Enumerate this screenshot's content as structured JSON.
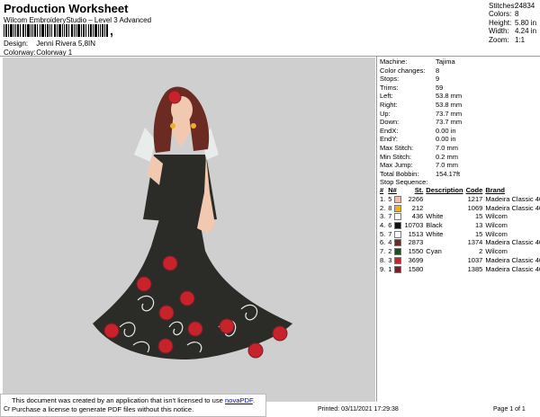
{
  "header": {
    "title": "Production Worksheet",
    "software": "Wilcom EmbroideryStudio – Level 3 Advanced",
    "barcode_suffix": ",",
    "design_label": "Design:",
    "design_value": "Jenni Rivera 5,8IN",
    "colorway_label": "Colorway:",
    "colorway_value": "Colorway 1"
  },
  "stats": [
    {
      "label": "Stitches:",
      "value": "24834"
    },
    {
      "label": "Colors:",
      "value": "8"
    },
    {
      "label": "Height:",
      "value": "5.80 in"
    },
    {
      "label": "Width:",
      "value": "4.24 in"
    },
    {
      "label": "Zoom:",
      "value": "1:1"
    }
  ],
  "machine_info": [
    {
      "label": "Machine:",
      "value": "Tajima"
    },
    {
      "label": "Color changes:",
      "value": "8"
    },
    {
      "label": "Stops:",
      "value": "9"
    },
    {
      "label": "Trims:",
      "value": "59"
    },
    {
      "label": "Left:",
      "value": "53.8 mm"
    },
    {
      "label": "Right:",
      "value": "53.8 mm"
    },
    {
      "label": "Up:",
      "value": "73.7 mm"
    },
    {
      "label": "Down:",
      "value": "73.7 mm"
    },
    {
      "label": "EndX:",
      "value": "0.00 in"
    },
    {
      "label": "EndY:",
      "value": "0.00 in"
    },
    {
      "label": "Max Stitch:",
      "value": "7.0 mm"
    },
    {
      "label": "Min Stitch:",
      "value": "0.2 mm"
    },
    {
      "label": "Max Jump:",
      "value": "7.0 mm"
    },
    {
      "label": "Total Bobbin:",
      "value": "154.17ft"
    }
  ],
  "stop_sequence": {
    "title": "Stop Sequence:",
    "headers": [
      "#",
      "N#",
      "St.",
      "Description",
      "Code",
      "Brand"
    ],
    "rows": [
      {
        "num": "1.",
        "n": "5",
        "color": "#f3b9a6",
        "st": "2266",
        "desc": "",
        "code": "1217",
        "brand": "Madeira Classic 40"
      },
      {
        "num": "2.",
        "n": "8",
        "color": "#e8b224",
        "st": "212",
        "desc": "",
        "code": "1069",
        "brand": "Madeira Classic 40"
      },
      {
        "num": "3.",
        "n": "7",
        "color": "#ffffff",
        "st": "436",
        "desc": "White",
        "code": "15",
        "brand": "Wilcom"
      },
      {
        "num": "4.",
        "n": "6",
        "color": "#111111",
        "st": "10703",
        "desc": "Black",
        "code": "13",
        "brand": "Wilcom"
      },
      {
        "num": "5.",
        "n": "7",
        "color": "#ffffff",
        "st": "1513",
        "desc": "White",
        "code": "15",
        "brand": "Wilcom"
      },
      {
        "num": "6.",
        "n": "4",
        "color": "#6b2b22",
        "st": "2873",
        "desc": "",
        "code": "1374",
        "brand": "Madeira Classic 40"
      },
      {
        "num": "7.",
        "n": "2",
        "color": "#1e4d1e",
        "st": "1550",
        "desc": "Cyan",
        "code": "2",
        "brand": "Wilcom"
      },
      {
        "num": "8.",
        "n": "3",
        "color": "#c8222a",
        "st": "3699",
        "desc": "",
        "code": "1037",
        "brand": "Madeira Classic 40"
      },
      {
        "num": "9.",
        "n": "1",
        "color": "#7a1f2a",
        "st": "1580",
        "desc": "",
        "code": "1385",
        "brand": "Madeira Classic 40"
      }
    ]
  },
  "footer": {
    "left": "Cr",
    "printed": "Printed: 03/11/2021 17:29:38",
    "page": "Page 1 of 1"
  },
  "notice": {
    "line1_pre": "This document was created by an application that isn't licensed to use ",
    "link": "novaPDF",
    "line1_post": ".",
    "line2": "Purchase a license to generate PDF files without this notice."
  },
  "colors": {
    "panel_bg": "#cfcfcf",
    "dress": "#2b2b27",
    "rose": "#c8222a",
    "skin": "#f1c9b1",
    "hair": "#6b2b22"
  }
}
